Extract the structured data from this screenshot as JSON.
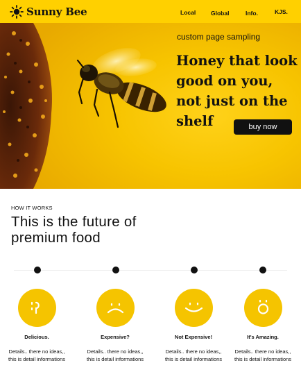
{
  "header": {
    "logo_text": "Sunny Bee",
    "nav": [
      "Local",
      "Global",
      "Info.",
      "KJS."
    ]
  },
  "hero": {
    "tagline": "custom page sampling",
    "title": "Honey that look good on you, not just on the shelf",
    "cta_label": "buy now"
  },
  "how_it_works": {
    "label": "HOW IT WORKS",
    "title": "This is the future of premium food",
    "features": [
      {
        "icon": "tongue-out-face-icon",
        "title": "Delicious.",
        "desc_line1": "Details.. there no ideas,,",
        "desc_line2": "this is detail informations"
      },
      {
        "icon": "frown-face-icon",
        "title": "Expensive?",
        "desc_line1": "Details.. there no ideas,,",
        "desc_line2": "this is detail informations"
      },
      {
        "icon": "smile-face-icon",
        "title": "Not Expensive!",
        "desc_line1": "Details.. there no ideas,,",
        "desc_line2": "this is detail informations"
      },
      {
        "icon": "surprised-face-icon",
        "title": "It's Amazing.",
        "desc_line1": "Details.. there no ideas,,",
        "desc_line2": "this is detail informations"
      }
    ]
  },
  "colors": {
    "brand_yellow": "#ffd000",
    "face_yellow": "#f5c400",
    "cta_background": "#111111"
  }
}
